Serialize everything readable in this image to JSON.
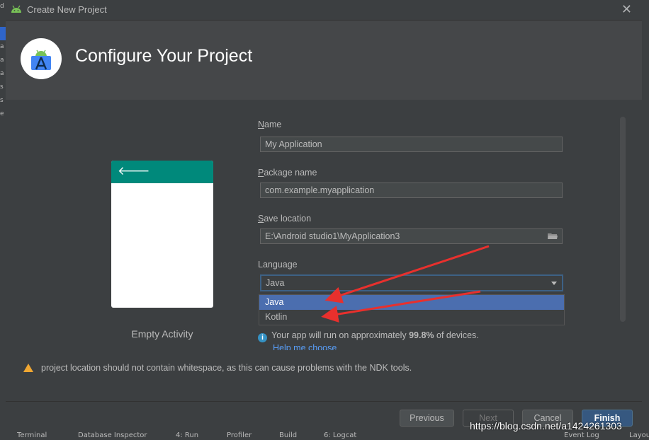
{
  "window": {
    "title": "Create New Project",
    "close_glyph": "✕"
  },
  "banner": {
    "heading": "Configure Your Project"
  },
  "template": {
    "label": "Empty Activity",
    "back_glyph": "🡐"
  },
  "form": {
    "name": {
      "label_key": "N",
      "label_rest": "ame",
      "value": "My Application"
    },
    "package": {
      "label_key": "P",
      "label_rest": "ackage name",
      "value": "com.example.myapplication"
    },
    "location": {
      "label_key": "S",
      "label_rest": "ave location",
      "value": "E:\\Android studio1\\MyApplication3"
    },
    "language": {
      "label": "Language",
      "selected": "Java",
      "options": [
        "Java",
        "Kotlin"
      ]
    }
  },
  "info": {
    "prefix": "Your app will run on approximately ",
    "percent": "99.8%",
    "suffix": " of devices.",
    "help_link": "Help me choose"
  },
  "warning": {
    "text": "project location should not contain whitespace, as this can cause problems with the NDK tools."
  },
  "buttons": {
    "previous": "Previous",
    "next": "Next",
    "cancel": "Cancel",
    "finish": "Finish"
  },
  "statusbar": {
    "items": [
      "Terminal",
      "Database Inspector",
      "4: Run",
      "Profiler",
      "Build",
      "6: Logcat",
      "Event Log",
      "Layout"
    ]
  },
  "watermark": "https://blog.csdn.net/a1424261303",
  "colors": {
    "accent": "#4b6eaf",
    "appbar": "#00897b",
    "annotation": "#e8302d"
  }
}
